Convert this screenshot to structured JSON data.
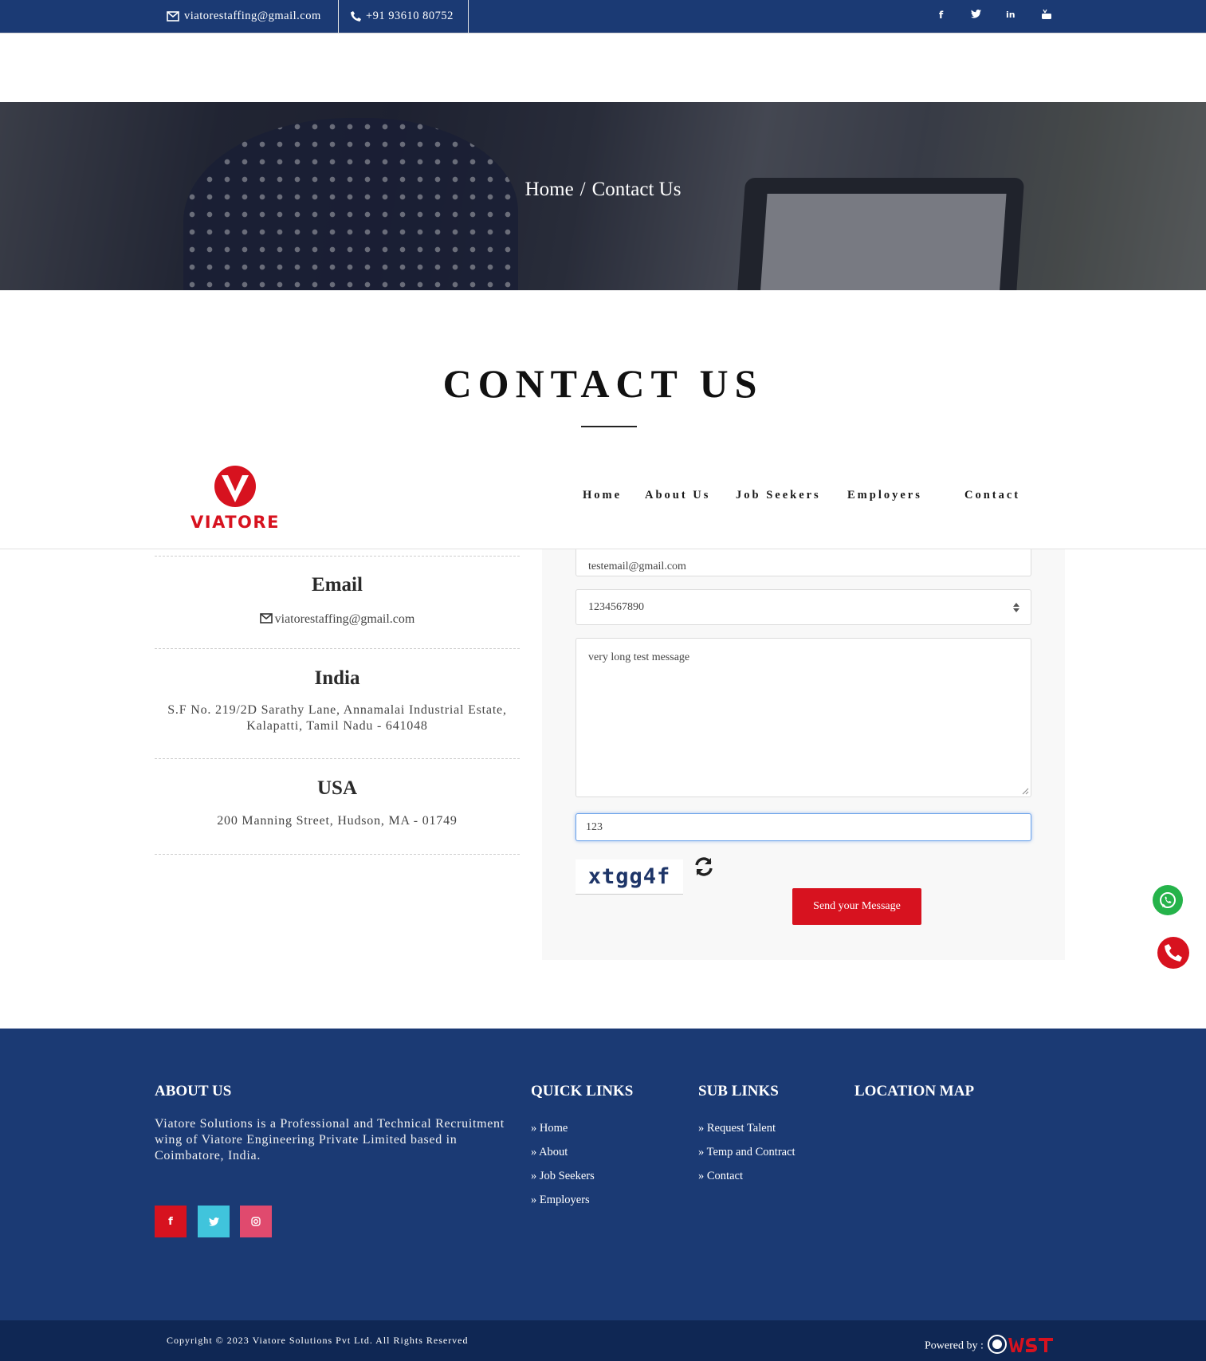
{
  "topbar": {
    "email": "viatorestaffing@gmail.com",
    "phone": "+91 93610 80752",
    "social": [
      "facebook-icon",
      "twitter-icon",
      "linkedin-icon",
      "youtube-icon"
    ]
  },
  "hero": {
    "breadcrumb_home": "Home",
    "breadcrumb_sep": "/",
    "breadcrumb_current": "Contact Us"
  },
  "page_title": "CONTACT US",
  "nav": {
    "logo_text": "VIATORE",
    "items": [
      "Home",
      "About Us",
      "Job Seekers",
      "Employers",
      "Contact"
    ]
  },
  "contact_info": {
    "email_title": "Email",
    "email_value": "viatorestaffing@gmail.com",
    "india_title": "India",
    "india_address_line1": "S.F No. 219/2D Sarathy Lane, Annamalai Industrial Estate,",
    "india_address_line2": "Kalapatti, Tamil Nadu - 641048",
    "usa_title": "USA",
    "usa_address": "200 Manning Street, Hudson, MA - 01749"
  },
  "form": {
    "email_value": "testemail@gmail.com",
    "phone_value": "1234567890",
    "message_value": "very long test message",
    "captcha_input_value": "123",
    "captcha_code": "xtgg4f",
    "send_label": "Send your Message"
  },
  "footer": {
    "about_title": "ABOUT US",
    "about_text": "Viatore Solutions is a Professional and Technical Recruitment wing of Viatore Engineering Private Limited based in Coimbatore, India.",
    "quick_title": "QUICK LINKS",
    "quick_links": [
      "Home",
      "About",
      "Job Seekers",
      "Employers"
    ],
    "sub_title": "SUB LINKS",
    "sub_links": [
      "Request Talent",
      "Temp and Contract",
      "Contact"
    ],
    "map_title": "LOCATION MAP",
    "social": [
      "facebook-icon",
      "twitter-icon",
      "instagram-icon"
    ],
    "social_colors": [
      "#d7121f",
      "#40c4dc",
      "#e04a6e"
    ],
    "copyright": "Copyright © 2023 Viatore Solutions Pvt Ltd. All Rights Reserved",
    "powered_by": "Powered by :"
  },
  "colors": {
    "navy": "#1b3a74",
    "brand_red": "#d7121f",
    "whatsapp_green": "#25b34a"
  }
}
